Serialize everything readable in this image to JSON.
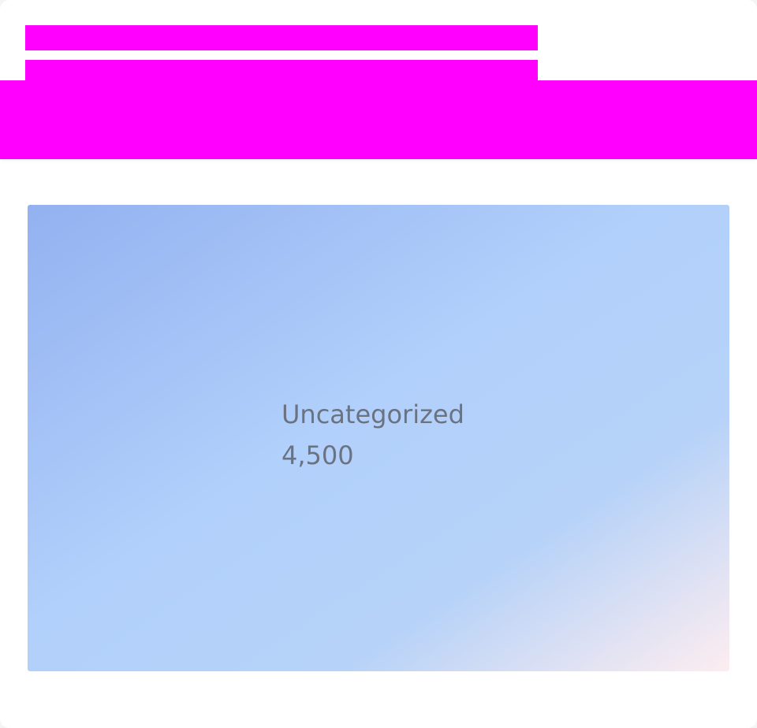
{
  "header": {
    "title": "",
    "subtitle": ""
  },
  "colors": {
    "redaction": "#ff00ff",
    "tile_gradient_start": "#93b1f0",
    "tile_gradient_mid": "#b1d0fb",
    "tile_gradient_end": "#fdedf0",
    "label_color": "#6b7280"
  },
  "chart_data": {
    "type": "treemap",
    "title": "",
    "items": [
      {
        "name": "Uncategorized",
        "value": 4500,
        "value_label": "4,500"
      }
    ]
  }
}
